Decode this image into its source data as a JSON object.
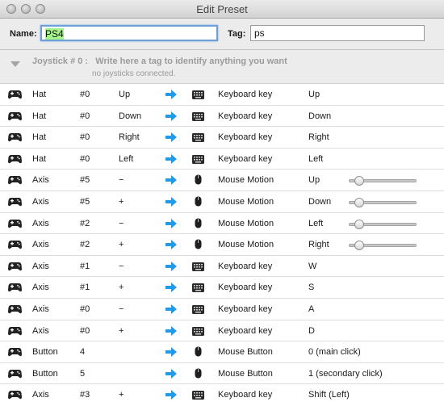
{
  "window": {
    "title": "Edit Preset"
  },
  "form": {
    "name_label": "Name:",
    "name_value": "PS4",
    "tag_label": "Tag:",
    "tag_value": "ps"
  },
  "joystick": {
    "label": "Joystick # 0 :",
    "placeholder": "Write here a tag to identify anything you want",
    "status": "no joysticks connected."
  },
  "rows": [
    {
      "type": "Hat",
      "num": "#0",
      "dir": "Up",
      "out_icon": "keyboard-icon",
      "out_type": "Keyboard key",
      "out_value": "Up"
    },
    {
      "type": "Hat",
      "num": "#0",
      "dir": "Down",
      "out_icon": "keyboard-icon",
      "out_type": "Keyboard key",
      "out_value": "Down"
    },
    {
      "type": "Hat",
      "num": "#0",
      "dir": "Right",
      "out_icon": "keyboard-icon",
      "out_type": "Keyboard key",
      "out_value": "Right"
    },
    {
      "type": "Hat",
      "num": "#0",
      "dir": "Left",
      "out_icon": "keyboard-icon",
      "out_type": "Keyboard key",
      "out_value": "Left"
    },
    {
      "type": "Axis",
      "num": "#5",
      "dir": "−",
      "out_icon": "mouse-icon",
      "out_type": "Mouse Motion",
      "out_value": "Up",
      "slider": 0.08
    },
    {
      "type": "Axis",
      "num": "#5",
      "dir": "+",
      "out_icon": "mouse-icon",
      "out_type": "Mouse Motion",
      "out_value": "Down",
      "slider": 0.08
    },
    {
      "type": "Axis",
      "num": "#2",
      "dir": "−",
      "out_icon": "mouse-icon",
      "out_type": "Mouse Motion",
      "out_value": "Left",
      "slider": 0.08
    },
    {
      "type": "Axis",
      "num": "#2",
      "dir": "+",
      "out_icon": "mouse-icon",
      "out_type": "Mouse Motion",
      "out_value": "Right",
      "slider": 0.08
    },
    {
      "type": "Axis",
      "num": "#1",
      "dir": "−",
      "out_icon": "keyboard-icon",
      "out_type": "Keyboard key",
      "out_value": "W"
    },
    {
      "type": "Axis",
      "num": "#1",
      "dir": "+",
      "out_icon": "keyboard-icon",
      "out_type": "Keyboard key",
      "out_value": "S"
    },
    {
      "type": "Axis",
      "num": "#0",
      "dir": "−",
      "out_icon": "keyboard-icon",
      "out_type": "Keyboard key",
      "out_value": "A"
    },
    {
      "type": "Axis",
      "num": "#0",
      "dir": "+",
      "out_icon": "keyboard-icon",
      "out_type": "Keyboard key",
      "out_value": "D"
    },
    {
      "type": "Button",
      "num": "4",
      "dir": "",
      "out_icon": "mouse-icon",
      "out_type": "Mouse Button",
      "out_value": "0 (main click)"
    },
    {
      "type": "Button",
      "num": "5",
      "dir": "",
      "out_icon": "mouse-icon",
      "out_type": "Mouse Button",
      "out_value": "1 (secondary click)"
    },
    {
      "type": "Axis",
      "num": "#3",
      "dir": "+",
      "out_icon": "keyboard-icon",
      "out_type": "Keyboard key",
      "out_value": "Shift (Left)"
    }
  ],
  "colors": {
    "arrow": "#1e9bea",
    "name_selection": "#a4f48a",
    "focus_ring": "#6da0d8"
  }
}
